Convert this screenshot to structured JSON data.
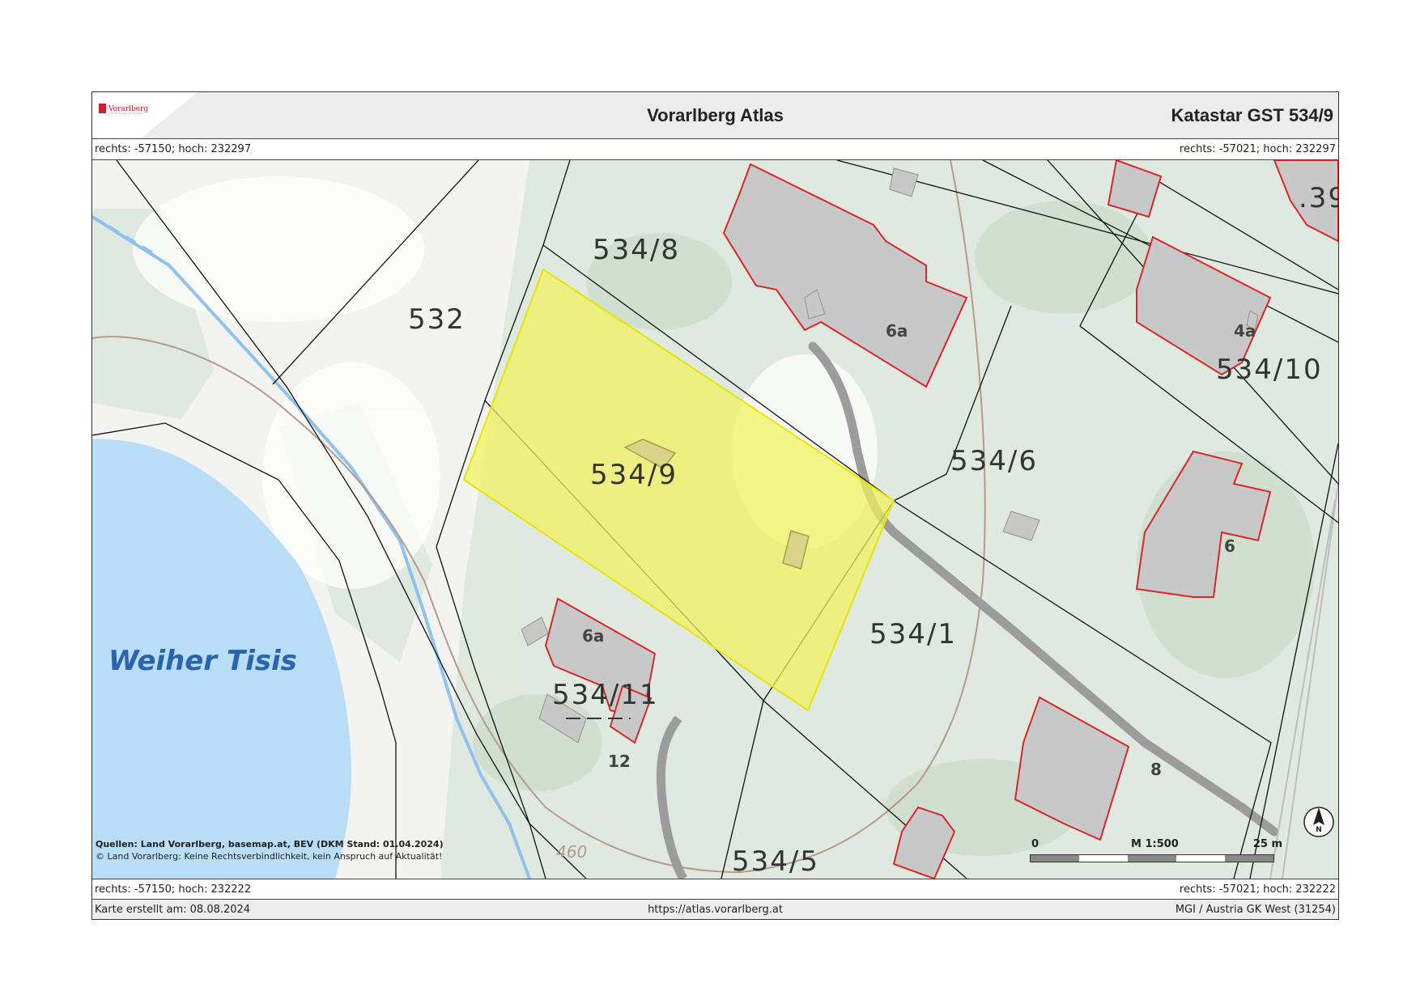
{
  "header": {
    "logo_text": "Vorarlberg",
    "title": "Vorarlberg Atlas",
    "parcel_title": "Katastar GST 534/9"
  },
  "coords": {
    "top_left": "rechts: -57150; hoch: 232297",
    "top_right": "rechts: -57021; hoch: 232297",
    "bottom_left": "rechts: -57150; hoch: 232222",
    "bottom_right": "rechts: -57021; hoch: 232222"
  },
  "map": {
    "highlighted_parcel": "534/9",
    "highlight_color": "#f2f25c",
    "parcels": [
      "534/8",
      "532",
      "534/9",
      "534/6",
      "534/10",
      "534/1",
      "534/11",
      "534/5",
      ".39"
    ],
    "house_numbers": [
      "6a",
      "4a",
      "6",
      "6a",
      "12",
      "8"
    ],
    "contour_labels": [
      "460",
      "460"
    ],
    "water_label": "Weiher Tisis",
    "water_color": "#b9dcf7",
    "building_outline_color": "#d9262c",
    "north_arrow": "N"
  },
  "sources": {
    "line1": "Quellen: Land Vorarlberg, basemap.at, BEV (DKM Stand: 01.04.2024)",
    "line2": "© Land Vorarlberg: Keine Rechtsverbindlichkeit, kein Anspruch auf Aktualität!"
  },
  "scale": {
    "start": "0",
    "ratio": "M 1:500",
    "end": "25 m"
  },
  "footer": {
    "created": "Karte erstellt am: 08.08.2024",
    "url": "https://atlas.vorarlberg.at",
    "crs": "MGI / Austria GK West (31254)"
  }
}
